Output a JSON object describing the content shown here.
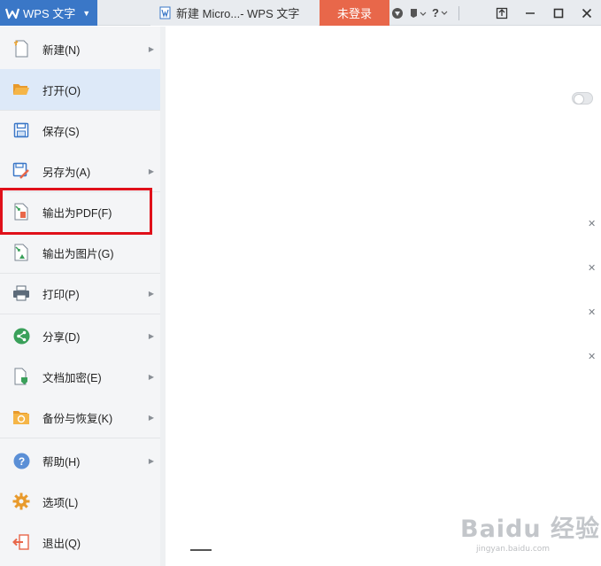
{
  "titlebar": {
    "app_name": "WPS 文字",
    "doc_title": "新建 Micro...- WPS 文字",
    "login_label": "未登录",
    "help_label": "?"
  },
  "menu": {
    "items": [
      {
        "label": "新建(N)",
        "icon": "new-doc-icon",
        "has_arrow": true
      },
      {
        "label": "打开(O)",
        "icon": "open-folder-icon",
        "has_arrow": false,
        "active": true
      },
      {
        "label": "保存(S)",
        "icon": "save-icon",
        "has_arrow": false
      },
      {
        "label": "另存为(A)",
        "icon": "save-as-icon",
        "has_arrow": true
      },
      {
        "label": "输出为PDF(F)",
        "icon": "export-pdf-icon",
        "has_arrow": false,
        "highlighted": true
      },
      {
        "label": "输出为图片(G)",
        "icon": "export-image-icon",
        "has_arrow": false
      },
      {
        "label": "打印(P)",
        "icon": "print-icon",
        "has_arrow": true
      },
      {
        "label": "分享(D)",
        "icon": "share-icon",
        "has_arrow": true
      },
      {
        "label": "文档加密(E)",
        "icon": "encrypt-icon",
        "has_arrow": true
      },
      {
        "label": "备份与恢复(K)",
        "icon": "backup-icon",
        "has_arrow": true
      },
      {
        "label": "帮助(H)",
        "icon": "help-icon",
        "has_arrow": true
      },
      {
        "label": "选项(L)",
        "icon": "options-gear-icon",
        "has_arrow": false
      },
      {
        "label": "退出(Q)",
        "icon": "exit-icon",
        "has_arrow": false
      }
    ]
  },
  "watermark": {
    "main": "Baidu 经验",
    "sub": "jingyan.baidu.com"
  },
  "colors": {
    "app_blue": "#3a77c7",
    "login_orange": "#e8674a",
    "highlight_red": "#e0101a",
    "active_item": "#dde9f8"
  }
}
